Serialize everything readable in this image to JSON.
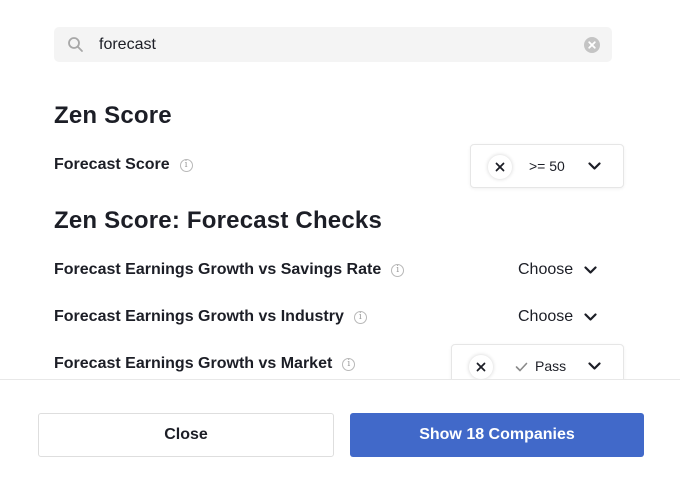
{
  "search": {
    "value": "forecast",
    "placeholder": ""
  },
  "sections": {
    "zen_score": {
      "title": "Zen Score",
      "forecast_score": {
        "label": "Forecast Score",
        "value": ">= 50"
      }
    },
    "forecast_checks": {
      "title": "Zen Score: Forecast Checks",
      "rows": [
        {
          "label": "Forecast Earnings Growth vs Savings Rate",
          "value": "Choose"
        },
        {
          "label": "Forecast Earnings Growth vs Industry",
          "value": "Choose"
        },
        {
          "label": "Forecast Earnings Growth vs Market",
          "value": "Pass"
        }
      ]
    }
  },
  "footer": {
    "close_label": "Close",
    "show_label": "Show 18 Companies"
  },
  "colors": {
    "primary": "#4169c9",
    "text": "#1c1e26",
    "search_bg": "#f4f4f4"
  },
  "icons": [
    "search-icon",
    "clear-icon",
    "info-icon",
    "close-icon",
    "chevron-down-icon",
    "check-icon"
  ]
}
